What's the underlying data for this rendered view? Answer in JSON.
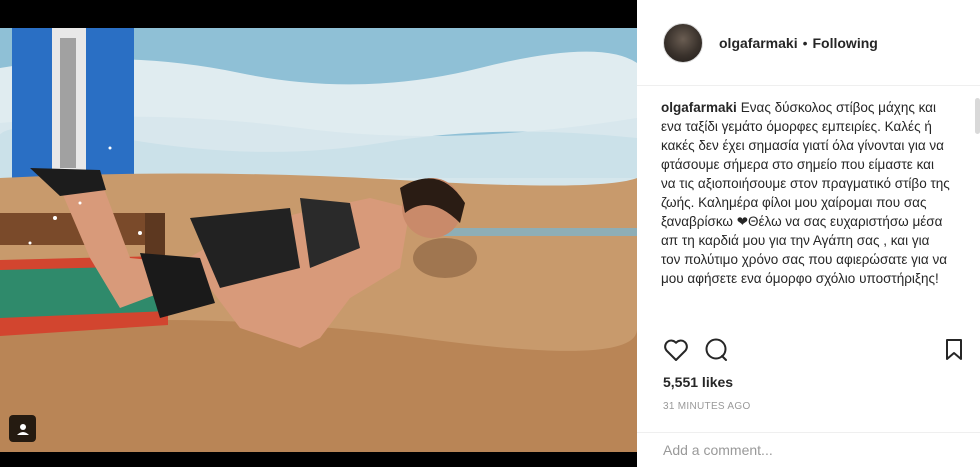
{
  "post": {
    "username": "olgafarmaki",
    "follow_status": "Following",
    "separator": "•",
    "caption_user": "olgafarmaki",
    "caption_text": "Ενας δύσκολος στίβος μάχης και ενα ταξίδι γεμάτο όμορφες εμπειρίες. Καλές ή κακές δεν έχει σημασία γιατί όλα γίνονται για να φτάσουμε σήμερα στο σημείο που είμαστε και να τις αξιοποιήσουμε στον πραγματικό στίβο της ζωής. Καλημέρα φίλοι μου χαίρομαι που σας ξαναβρίσκω ❤Θέλω να σας ευχαριστήσω μέσα απ τη καρδιά μου για την Αγάπη σας , και για τον πολύτιμο χρόνο σας που αφιερώσατε για να μου αφήσετε ενα όμορφο σχόλιο υποστήριξης!",
    "likes": "5,551 likes",
    "timestamp": "31 MINUTES AGO"
  },
  "comment_box": {
    "placeholder": "Add a comment..."
  },
  "icons": {
    "like": "heart-icon",
    "comment": "comment-bubble-icon",
    "save": "bookmark-icon",
    "tagged_users": "user-tag-icon"
  }
}
